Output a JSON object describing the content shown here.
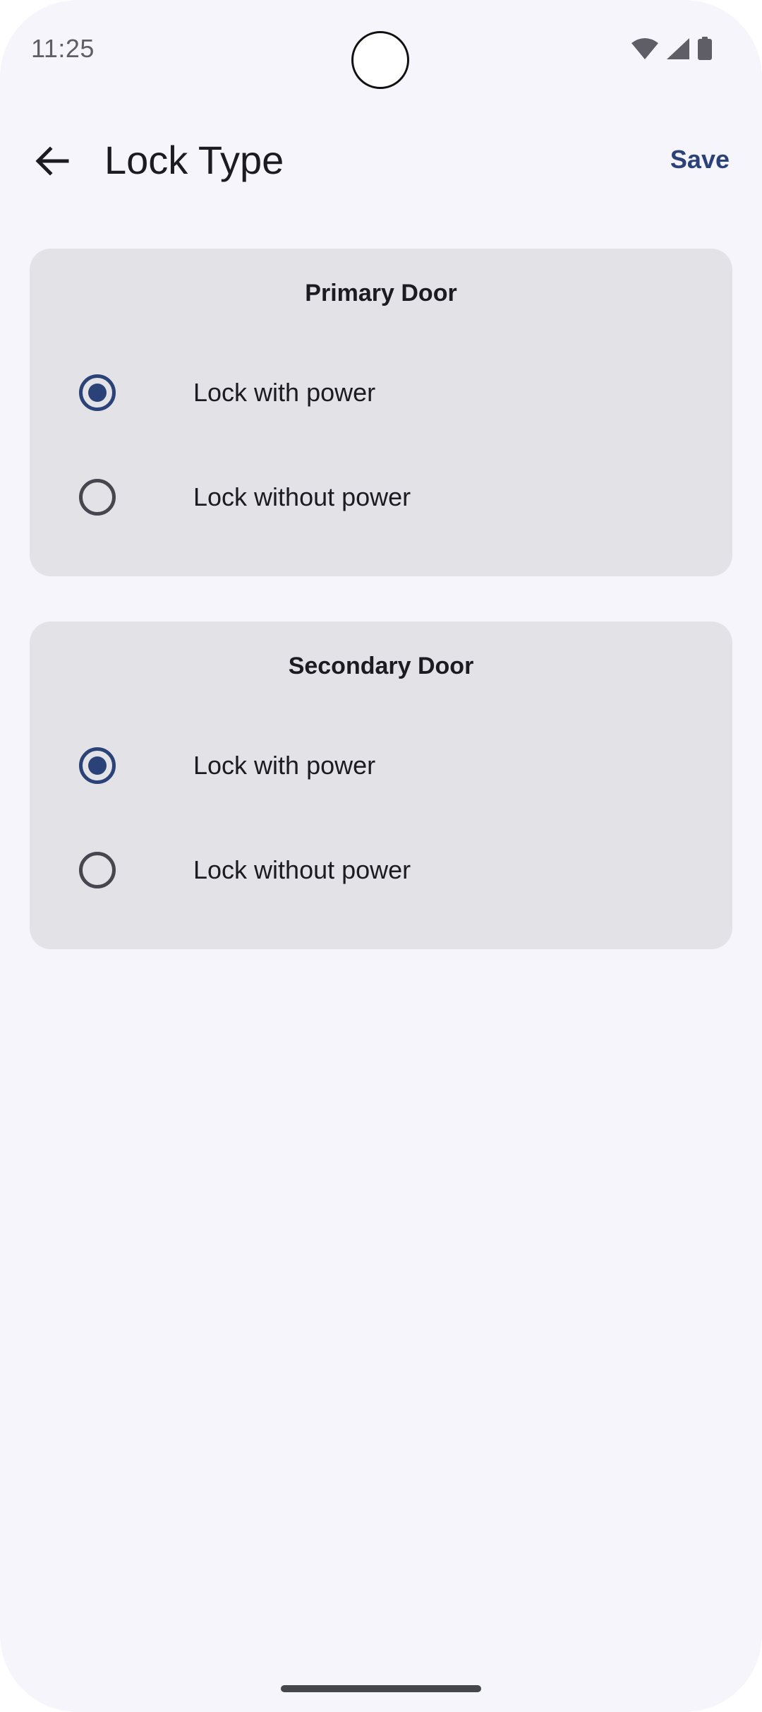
{
  "status_bar": {
    "time": "11:25"
  },
  "app_bar": {
    "title": "Lock Type",
    "save_label": "Save",
    "back_icon": "arrow-back-icon"
  },
  "cards": [
    {
      "title": "Primary Door",
      "options": [
        {
          "label": "Lock with power",
          "checked": true
        },
        {
          "label": "Lock without power",
          "checked": false
        }
      ]
    },
    {
      "title": "Secondary Door",
      "options": [
        {
          "label": "Lock with power",
          "checked": true
        },
        {
          "label": "Lock without power",
          "checked": false
        }
      ]
    }
  ],
  "colors": {
    "background": "#f6f5fb",
    "card": "#e2e2e7",
    "accent": "#2b4278",
    "text": "#1b1b21"
  }
}
